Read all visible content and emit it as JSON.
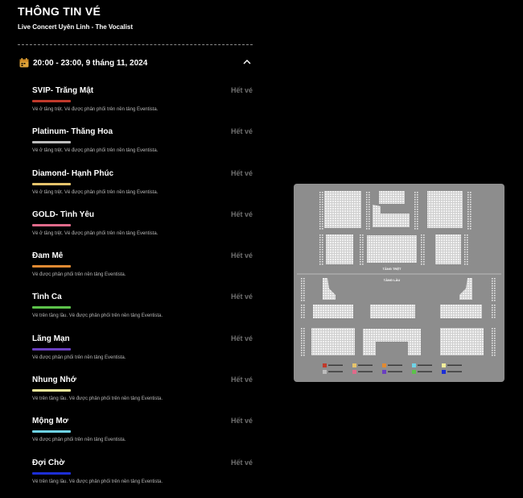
{
  "page": {
    "title": "THÔNG TIN VÉ",
    "event_name": "Live Concert Uyên Linh - The Vocalist"
  },
  "session": {
    "time": "20:00 - 23:00, 9 tháng 11, 2024",
    "icon": "calendar-icon",
    "toggle_icon": "chevron-up-icon"
  },
  "tickets": [
    {
      "name": "SVIP- Trăng Mật",
      "color": "#c0392b",
      "desc": "Vé ở tầng trệt. Vé được phân phối trên nền tảng Eventista.",
      "status": "Hết vé"
    },
    {
      "name": "Platinum- Thăng Hoa",
      "color": "#bdbdbd",
      "desc": "Vé ở tầng trệt. Vé được phân phối trên nền tảng Eventista.",
      "status": "Hết vé"
    },
    {
      "name": "Diamond- Hạnh Phúc",
      "color": "#e5c36b",
      "desc": "Vé ở tầng trệt. Vé được phân phối trên nền tảng Eventista.",
      "status": "Hết vé"
    },
    {
      "name": "GOLD- Tình Yêu",
      "color": "#e06a8a",
      "desc": "Vé ở tầng trệt. Vé được phân phối trên nền tảng Eventista.",
      "status": "Hết vé"
    },
    {
      "name": "Đam Mê",
      "color": "#e08a33",
      "desc": "Vé được phân phối trên nền tảng Eventista.",
      "status": "Hết vé"
    },
    {
      "name": "Tình Ca",
      "color": "#5cc24a",
      "desc": "Vé trên tầng lầu. Vé được phân phối trên nền tảng Eventista.",
      "status": "Hết vé"
    },
    {
      "name": "Lãng Mạn",
      "color": "#6a3fc0",
      "desc": "Vé được phân phối trên nền tảng Eventista.",
      "status": "Hết vé"
    },
    {
      "name": "Nhung Nhớ",
      "color": "#f2ee9a",
      "desc": "Vé trên tầng lầu. Vé được phân phối trên nền tảng Eventista.",
      "status": "Hết vé"
    },
    {
      "name": "Mộng Mơ",
      "color": "#6fd3e6",
      "desc": "Vé được phân phối trên nền tảng Eventista.",
      "status": "Hết vé"
    },
    {
      "name": "Đợi Chờ",
      "color": "#1c2ed6",
      "desc": "Vé trên tầng lầu. Vé được phân phối trên nền tảng Eventista.",
      "status": "Hết vé"
    }
  ],
  "seat_map": {
    "ground_floor_label": "TẦNG TRỆT",
    "upper_floor_label": "TẦNG LẦU",
    "legend_colors": [
      "#c0392b",
      "#e5c36b",
      "#e08a33",
      "#6fd3e6",
      "#f2ee9a",
      "#bdbdbd",
      "#e06a8a",
      "#6a3fc0",
      "#5cc24a",
      "#1c2ed6"
    ]
  }
}
